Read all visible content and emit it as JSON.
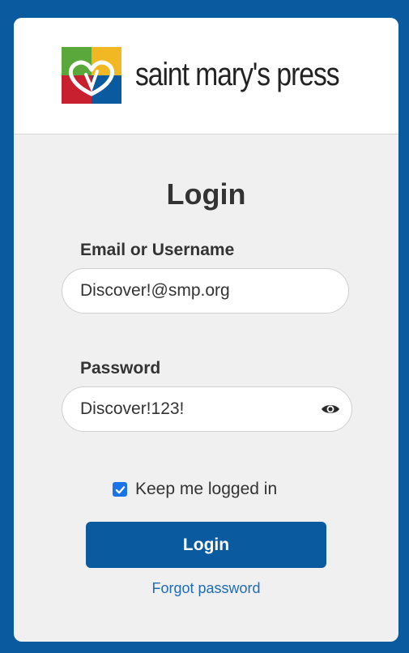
{
  "brand": {
    "name": "saint mary's press",
    "logo_icon": "saint-marys-press-logo-icon",
    "colors": {
      "red": "#c8202f",
      "green": "#5aa83c",
      "blue": "#0a5aa0",
      "yellow": "#f2b824"
    }
  },
  "login_form": {
    "title": "Login",
    "email": {
      "label": "Email or Username",
      "value": "Discover!@smp.org"
    },
    "password": {
      "label": "Password",
      "value": "Discover!123!",
      "toggle_icon": "eye-icon"
    },
    "remember_me": {
      "label": "Keep me logged in",
      "checked": true
    },
    "submit_label": "Login",
    "forgot_password_label": "Forgot password"
  },
  "theme": {
    "page_background": "#0a5aa0",
    "card_background": "#f0f0f1",
    "button_color": "#0a5aa0",
    "link_color": "#1f6bb8"
  }
}
